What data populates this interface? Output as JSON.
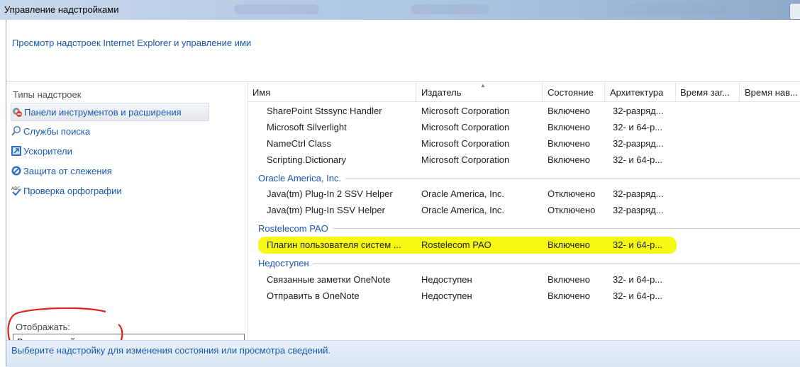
{
  "window": {
    "title": "Управление надстройками",
    "header_text": "Просмотр надстроек Internet Explorer и управление ими"
  },
  "left_panel": {
    "types_label": "Типы надстроек",
    "types": [
      {
        "label": "Панели инструментов и расширения",
        "icon": "gear-icon",
        "selected": true
      },
      {
        "label": "Службы поиска",
        "icon": "search-icon",
        "selected": false
      },
      {
        "label": "Ускорители",
        "icon": "accelerator-icon",
        "selected": false
      },
      {
        "label": "Защита от слежения",
        "icon": "block-icon",
        "selected": false
      },
      {
        "label": "Проверка орфографии",
        "icon": "spellcheck-icon",
        "selected": false
      }
    ],
    "show_label": "Отображать:",
    "show_value": "Все надстройки"
  },
  "table": {
    "columns": [
      "Имя",
      "Издатель",
      "Состояние",
      "Архитектура",
      "Время заг...",
      "Время нав..."
    ],
    "rows_top": [
      {
        "name": "SharePoint Stssync Handler",
        "publisher": "Microsoft Corporation",
        "state": "Включено",
        "arch": "32-разряд..."
      },
      {
        "name": "Microsoft Silverlight",
        "publisher": "Microsoft Corporation",
        "state": "Включено",
        "arch": "32- и 64-р..."
      },
      {
        "name": "NameCtrl Class",
        "publisher": "Microsoft Corporation",
        "state": "Включено",
        "arch": "32-разряд..."
      },
      {
        "name": "Scripting.Dictionary",
        "publisher": "Microsoft Corporation",
        "state": "Включено",
        "arch": "32- и 64-р..."
      }
    ],
    "group_oracle": "Oracle America, Inc.",
    "rows_oracle": [
      {
        "name": "Java(tm) Plug-In 2 SSV Helper",
        "publisher": "Oracle America, Inc.",
        "state": "Отключено",
        "arch": "32-разряд..."
      },
      {
        "name": "Java(tm) Plug-In SSV Helper",
        "publisher": "Oracle America, Inc.",
        "state": "Отключено",
        "arch": "32-разряд..."
      }
    ],
    "group_rostelecom": "Rostelecom PAO",
    "rows_rostelecom": [
      {
        "name": "Плагин пользователя систем ...",
        "publisher": "Rostelecom PAO",
        "state": "Включено",
        "arch": "32- и 64-р..."
      }
    ],
    "group_unavailable": "Недоступен",
    "rows_unavailable": [
      {
        "name": "Связанные заметки OneNote",
        "publisher": "Недоступен",
        "state": "Включено",
        "arch": "32- и 64-р..."
      },
      {
        "name": "Отправить в OneNote",
        "publisher": "Недоступен",
        "state": "Включено",
        "arch": "32- и 64-р..."
      }
    ]
  },
  "status_text": "Выберите надстройку для изменения состояния или просмотра сведений.",
  "colors": {
    "link_blue": "#1a56b0",
    "highlight_yellow": "#f6f600",
    "annotation_red": "#e0201b"
  }
}
